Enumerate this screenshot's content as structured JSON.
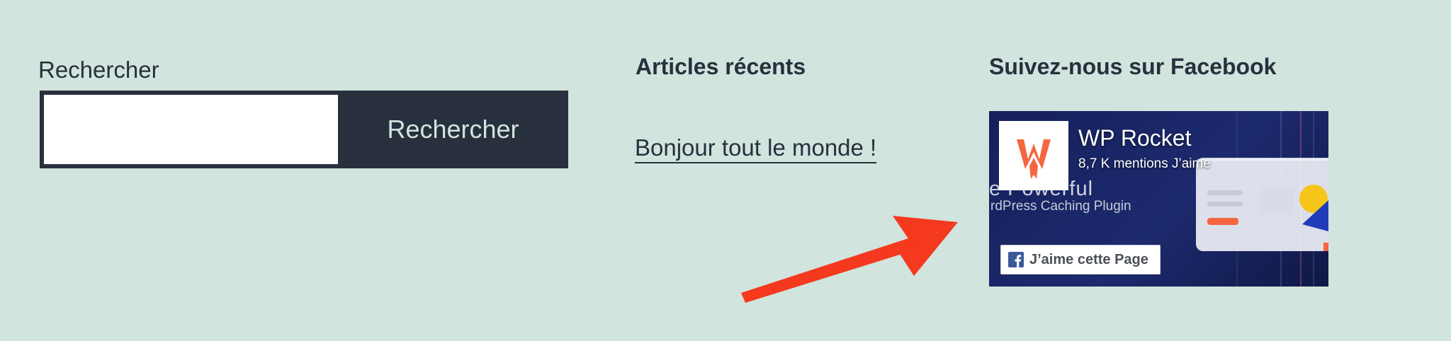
{
  "search": {
    "label": "Rechercher",
    "value": "",
    "button_label": "Rechercher"
  },
  "recent_posts": {
    "title": "Articles récents",
    "items": [
      {
        "label": "Bonjour tout le monde !"
      }
    ]
  },
  "facebook": {
    "title": "Suivez-nous sur Facebook",
    "page_name": "WP Rocket",
    "likes": "8,7 K mentions J’aime",
    "cover_text_line1": "e Powerful",
    "cover_text_line2": "rdPress Caching Plugin",
    "like_button_label": "J’aime cette Page",
    "logo_icon": "wp-rocket-logo-icon",
    "brand_color": "#f56640",
    "button_icon": "facebook-f-icon"
  },
  "annotation": {
    "arrow_icon": "red-arrow-icon",
    "color": "#f4391f"
  },
  "colors": {
    "background": "#d1e4dd",
    "text": "#28303d",
    "facebook_blue": "#3b5998"
  }
}
